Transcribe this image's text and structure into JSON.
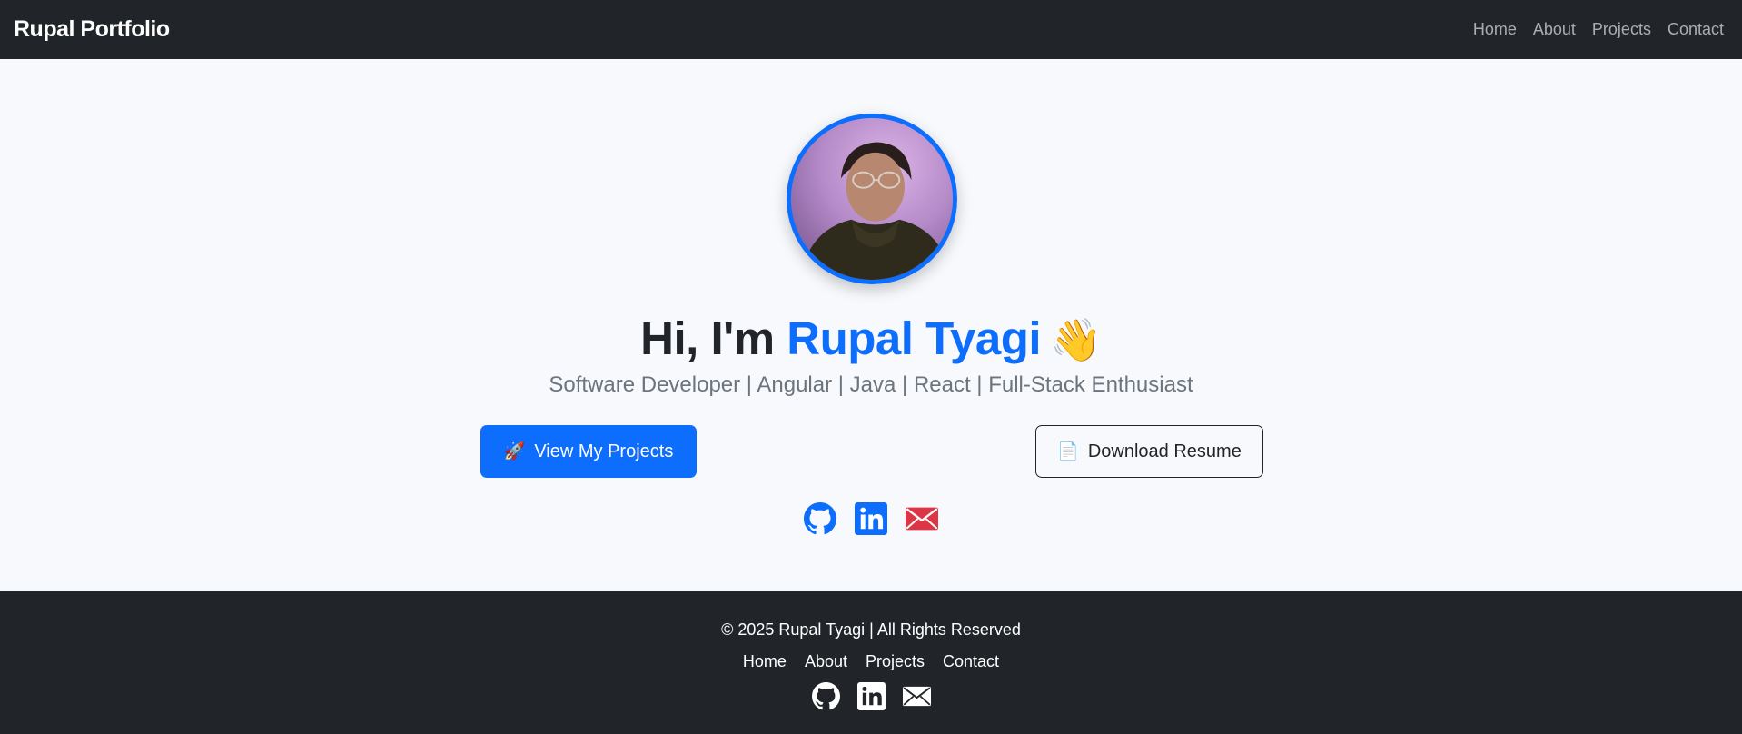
{
  "navbar": {
    "brand": "Rupal Portfolio",
    "links": [
      "Home",
      "About",
      "Projects",
      "Contact"
    ]
  },
  "hero": {
    "avatar_icon": "profile-photo",
    "greeting_prefix": "Hi, I'm",
    "name": "Rupal Tyagi",
    "wave_emoji": "👋",
    "subtitle": "Software Developer | Angular | Java | React | Full-Stack Enthusiast",
    "primary_button": {
      "icon": "🚀",
      "label": "View My Projects"
    },
    "secondary_button": {
      "icon": "📄",
      "label": "Download Resume"
    },
    "socials": [
      {
        "icon": "github-icon",
        "color": "#0d6efd"
      },
      {
        "icon": "linkedin-icon",
        "color": "#0d6efd"
      },
      {
        "icon": "mail-icon",
        "color": "#dc3545"
      }
    ]
  },
  "footer": {
    "copyright": "© 2025 Rupal Tyagi | All Rights Reserved",
    "links": [
      "Home",
      "About",
      "Projects",
      "Contact"
    ],
    "socials": [
      "github-icon",
      "linkedin-icon",
      "mail-icon"
    ]
  },
  "colors": {
    "accent": "#0d6efd",
    "dark": "#212529",
    "danger": "#dc3545",
    "muted": "#6c757d"
  }
}
